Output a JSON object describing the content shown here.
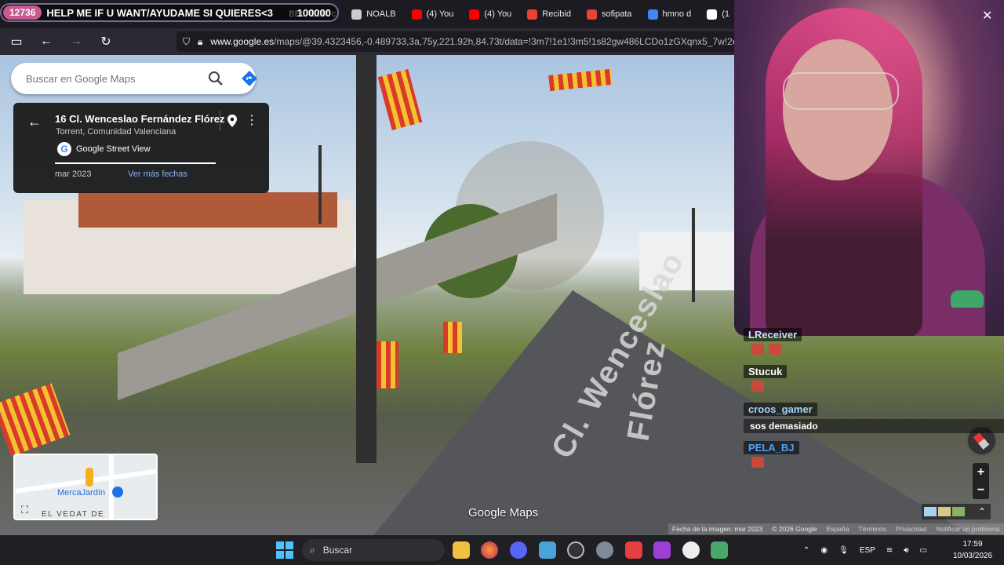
{
  "overlay": {
    "badge": "12736",
    "goal_text": "HELP ME IF U WANT/AYUDAME SI QUIERES<3",
    "goal_count": "100000"
  },
  "tabs": [
    {
      "label": "BELABOX c",
      "icon": "text-icon",
      "color": "#1c1b22"
    },
    {
      "label": "NOALB",
      "icon": "circle-icon",
      "color": "#cccccc"
    },
    {
      "label": "(4) You",
      "icon": "youtube-icon",
      "color": "#ff0000"
    },
    {
      "label": "(4) You",
      "icon": "youtube-icon",
      "color": "#ff0000"
    },
    {
      "label": "Recibid",
      "icon": "gmail-icon",
      "color": "#ea4335"
    },
    {
      "label": "sofipata",
      "icon": "gmail-icon",
      "color": "#ea4335"
    },
    {
      "label": "hmno d",
      "icon": "google-icon",
      "color": "#4285f4"
    },
    {
      "label": "(1",
      "icon": "x-icon",
      "color": "#ffffff"
    }
  ],
  "url": {
    "domain": "www.google.es",
    "path": "/maps/@39.4323456,-0.489733,3a,75y,221.92h,84.73t/data=!3m7!1e1!3m5!1s82gw486LCDo1zGXqnx5_7w!2e0!6shttps"
  },
  "search": {
    "placeholder": "Buscar en Google Maps"
  },
  "location": {
    "address": "16 Cl. Wenceslao Fernández Flórez",
    "region": "Torrent, Comunidad Valenciana",
    "source": "Google Street View",
    "date": "mar 2023",
    "more_dates": "Ver más fechas"
  },
  "road_text": {
    "part1": "Cl. Wenceslao",
    "part2": "Flórez"
  },
  "minimap": {
    "place": "MercaJardín",
    "area": "EL VEDAT DE"
  },
  "brand": "Google Maps",
  "footer": {
    "image_date": "Fecha de la imagen: mar 2023",
    "copyright": "© 2026 Google",
    "country": "España",
    "terms": "Términos",
    "privacy": "Privacidad",
    "report": "Notificar un problema"
  },
  "zoom": {
    "in": "+",
    "out": "−"
  },
  "chat": [
    {
      "user": "LReceiver",
      "color": "#bfe3ff",
      "message": "",
      "emotes": 2
    },
    {
      "user": "Stucuk",
      "color": "#ffffff",
      "message": "",
      "emotes": 1
    },
    {
      "user": "croos_gamer",
      "color": "#9fd3ff",
      "message": "sos demasiado",
      "emotes": 0
    },
    {
      "user": "PELA_BJ",
      "color": "#4aa3ff",
      "message": "",
      "emotes": 1
    }
  ],
  "taskbar": {
    "search": "Buscar",
    "lang": "ESP",
    "time": "17:59",
    "date": "10/03/2026"
  }
}
